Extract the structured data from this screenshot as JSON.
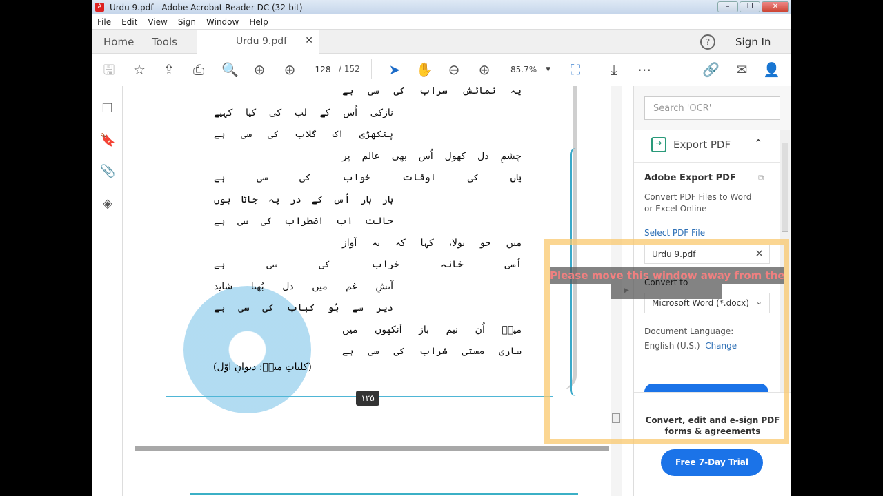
{
  "window": {
    "title": "Urdu 9.pdf - Adobe Acrobat Reader DC (32-bit)"
  },
  "menu": [
    "File",
    "Edit",
    "View",
    "Sign",
    "Window",
    "Help"
  ],
  "tabs": {
    "home": "Home",
    "tools": "Tools",
    "doc": "Urdu 9.pdf",
    "sign_in": "Sign In"
  },
  "toolbar": {
    "page_current": "128",
    "page_total": "/ 152",
    "zoom": "85.7%"
  },
  "document": {
    "lines": [
      "یہ نمائش سراب کی سی ہے",
      "نازکی اُس کے لب کی کیا کہیے",
      "پنکھڑی اک گلاب کی سی ہے",
      "چشمِ دل کھول اُس بھی عالم پر",
      "یاں کی اوقات خواب کی سی ہے",
      "بار بار اُس کے در پہ جاتا ہوں",
      "حالت اب اضطراب کی سی ہے",
      "میں جو بولا، کہا کہ یہ آواز",
      "اُسی خانہ خراب کی سی ہے",
      "آتشِ غم میں دل بُھنا شاید",
      "دیر سے بُو کباب کی سی ہے",
      "میرؔ اُن نیم باز آنکھوں میں",
      "ساری مستی شراب کی سی ہے"
    ],
    "reference": "(کلیاتِ میرؔ: دیوانِ اوّل)",
    "page_number": "۱۲۵"
  },
  "right_panel": {
    "search_placeholder": "Search 'OCR'",
    "export_title": "Export PDF",
    "heading": "Adobe Export PDF",
    "description": "Convert PDF Files to Word or Excel Online",
    "select_label": "Select PDF File",
    "file": "Urdu 9.pdf",
    "convert_label": "Convert to",
    "convert_value": "Microsoft Word (*.docx)",
    "lang_label": "Document Language:",
    "lang_value": "English (U.S.)",
    "lang_change": "Change",
    "promo": "Convert, edit and e-sign PDF forms & agreements",
    "trial": "Free 7-Day Trial"
  },
  "overlay": {
    "warning": "Please move this window away from the shared application."
  }
}
